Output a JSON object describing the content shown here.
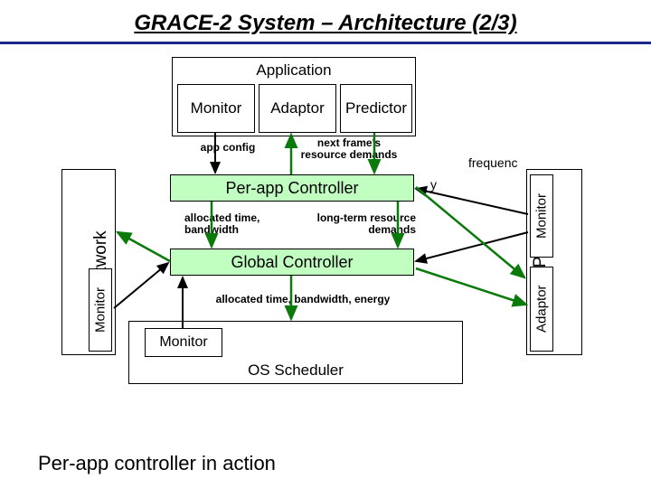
{
  "title": "GRACE-2 System – Architecture (2/3)",
  "application": {
    "label": "Application",
    "monitor": "Monitor",
    "adaptor": "Adaptor",
    "predictor": "Predictor"
  },
  "labels": {
    "app_config": "app config",
    "next_frame": "next frame's resource demands",
    "frequency": "frequenc",
    "frequency2": "y",
    "per_app": "Per-app Controller",
    "alloc_time": "allocated time, bandwidth",
    "long_term": "long-term resource demands",
    "global": "Global Controller",
    "alloc_energy": "allocated time, bandwidth, energy",
    "os_monitor": "Monitor",
    "os_scheduler": "OS Scheduler"
  },
  "side": {
    "network": "Network",
    "net_monitor": "Monitor",
    "cpu": "CPU",
    "cpu_monitor": "Monitor",
    "cpu_adaptor": "Adaptor"
  },
  "caption": "Per-app controller in action"
}
